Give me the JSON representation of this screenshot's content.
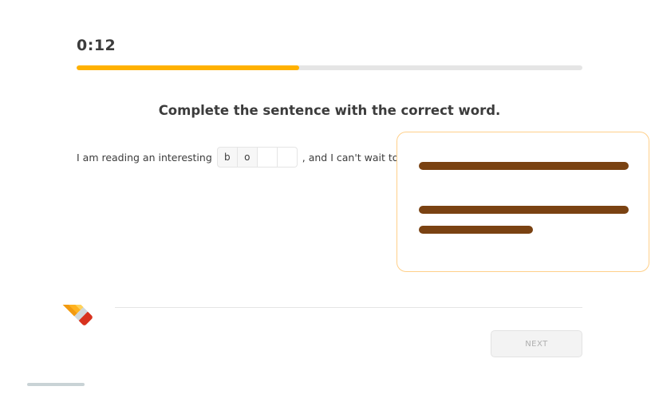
{
  "header": {
    "timer": "0:12",
    "progress": 0.44,
    "progress_color": "#ffb100"
  },
  "instruction": "Complete the sentence with the correct word.",
  "sentence": {
    "before": "I am reading an interesting",
    "letters": [
      "b",
      "o",
      "",
      ""
    ],
    "after": ", and I can't wait to find"
  },
  "hint_card": {
    "border_color": "#ffd08a",
    "line_color": "#7a4212"
  },
  "footer": {
    "next_label": "NEXT"
  },
  "icons": {
    "pencil": "pencil-icon"
  }
}
